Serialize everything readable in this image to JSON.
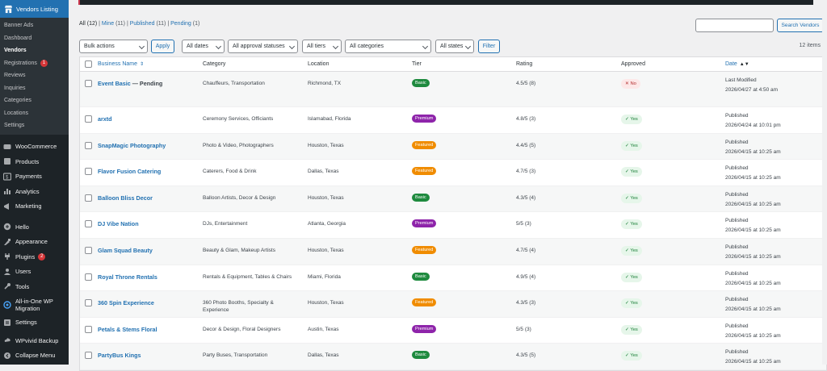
{
  "sidebar": {
    "active_plugin": "Vendors Listing",
    "submenu": [
      {
        "label": "Banner Ads"
      },
      {
        "label": "Dashboard"
      },
      {
        "label": "Vendors",
        "current": true
      },
      {
        "label": "Registrations",
        "badge": "1"
      },
      {
        "label": "Reviews"
      },
      {
        "label": "Inquiries"
      },
      {
        "label": "Categories"
      },
      {
        "label": "Locations"
      },
      {
        "label": "Settings"
      }
    ],
    "menu": [
      {
        "label": "WooCommerce",
        "icon": "woocommerce-icon"
      },
      {
        "label": "Products",
        "icon": "products-icon"
      },
      {
        "label": "Payments",
        "icon": "payments-icon"
      },
      {
        "label": "Analytics",
        "icon": "analytics-icon"
      },
      {
        "label": "Marketing",
        "icon": "marketing-icon"
      },
      {
        "label": "Hello",
        "icon": "hello-icon"
      },
      {
        "label": "Appearance",
        "icon": "appearance-icon"
      },
      {
        "label": "Plugins",
        "icon": "plugins-icon",
        "badge": "2"
      },
      {
        "label": "Users",
        "icon": "users-icon"
      },
      {
        "label": "Tools",
        "icon": "tools-icon"
      },
      {
        "label": "All-in-One WP Migration",
        "icon": "migration-icon"
      },
      {
        "label": "Settings",
        "icon": "settings-icon"
      },
      {
        "label": "WPvivid Backup",
        "icon": "backup-icon"
      },
      {
        "label": "Collapse Menu",
        "icon": "collapse-icon"
      }
    ]
  },
  "status_links": {
    "all": "All",
    "all_count": "(12)",
    "mine": "Mine",
    "mine_count": "(11)",
    "published": "Published",
    "published_count": "(11)",
    "pending": "Pending",
    "pending_count": "(1)",
    "sep": "|"
  },
  "search": {
    "placeholder": "",
    "button": "Search Vendors"
  },
  "filters": {
    "bulk_actions": "Bulk actions",
    "apply": "Apply",
    "dates": "All dates",
    "approval": "All approval statuses",
    "tiers": "All tiers",
    "categories": "All categories",
    "states": "All states",
    "filter": "Filter",
    "items_count": "12 items"
  },
  "table": {
    "headers": {
      "business_name": "Business Name",
      "category": "Category",
      "location": "Location",
      "tier": "Tier",
      "rating": "Rating",
      "approved": "Approved",
      "date": "Date"
    },
    "rows": [
      {
        "name": "Event Basic",
        "suffix": " — Pending",
        "category": "Chauffeurs, Transportation",
        "location": "Richmond, TX",
        "tier": "Basic",
        "tier_class": "basic",
        "rating": "4.5/5 (8)",
        "approved": "✕ No",
        "approved_class": "no",
        "date_status": "Last Modified",
        "date": "2026/04/27 at 4:50 am"
      },
      {
        "name": "arxtd",
        "suffix": "",
        "category": "Ceremony Services, Officiants",
        "location": "Islamabad, Florida",
        "tier": "Premium",
        "tier_class": "premium",
        "rating": "4.8/5 (3)",
        "approved": "✓ Yes",
        "approved_class": "yes",
        "date_status": "Published",
        "date": "2026/04/24 at 10:01 pm"
      },
      {
        "name": "SnapMagic Photography",
        "suffix": "",
        "category": "Photo & Video, Photographers",
        "location": "Houston, Texas",
        "tier": "Featured",
        "tier_class": "featured",
        "rating": "4.4/5 (5)",
        "approved": "✓ Yes",
        "approved_class": "yes",
        "date_status": "Published",
        "date": "2026/04/15 at 10:25 am"
      },
      {
        "name": "Flavor Fusion Catering",
        "suffix": "",
        "category": "Caterers, Food & Drink",
        "location": "Dallas, Texas",
        "tier": "Featured",
        "tier_class": "featured",
        "rating": "4.7/5 (3)",
        "approved": "✓ Yes",
        "approved_class": "yes",
        "date_status": "Published",
        "date": "2026/04/15 at 10:25 am"
      },
      {
        "name": "Balloon Bliss Decor",
        "suffix": "",
        "category": "Balloon Artists, Decor & Design",
        "location": "Houston, Texas",
        "tier": "Basic",
        "tier_class": "basic",
        "rating": "4.3/5 (4)",
        "approved": "✓ Yes",
        "approved_class": "yes",
        "date_status": "Published",
        "date": "2026/04/15 at 10:25 am"
      },
      {
        "name": "DJ Vibe Nation",
        "suffix": "",
        "category": "DJs, Entertainment",
        "location": "Atlanta, Georgia",
        "tier": "Premium",
        "tier_class": "premium",
        "rating": "5/5 (3)",
        "approved": "✓ Yes",
        "approved_class": "yes",
        "date_status": "Published",
        "date": "2026/04/15 at 10:25 am"
      },
      {
        "name": "Glam Squad Beauty",
        "suffix": "",
        "category": "Beauty & Glam, Makeup Artists",
        "location": "Houston, Texas",
        "tier": "Featured",
        "tier_class": "featured",
        "rating": "4.7/5 (4)",
        "approved": "✓ Yes",
        "approved_class": "yes",
        "date_status": "Published",
        "date": "2026/04/15 at 10:25 am"
      },
      {
        "name": "Royal Throne Rentals",
        "suffix": "",
        "category": "Rentals & Equipment, Tables & Chairs",
        "location": "Miami, Florida",
        "tier": "Basic",
        "tier_class": "basic",
        "rating": "4.9/5 (4)",
        "approved": "✓ Yes",
        "approved_class": "yes",
        "date_status": "Published",
        "date": "2026/04/15 at 10:25 am"
      },
      {
        "name": "360 Spin Experience",
        "suffix": "",
        "category": "360 Photo Booths, Specialty & Experience",
        "location": "Houston, Texas",
        "tier": "Featured",
        "tier_class": "featured",
        "rating": "4.3/5 (3)",
        "approved": "✓ Yes",
        "approved_class": "yes",
        "date_status": "Published",
        "date": "2026/04/15 at 10:25 am"
      },
      {
        "name": "Petals & Stems Floral",
        "suffix": "",
        "category": "Decor & Design, Floral Designers",
        "location": "Austin, Texas",
        "tier": "Premium",
        "tier_class": "premium",
        "rating": "5/5 (3)",
        "approved": "✓ Yes",
        "approved_class": "yes",
        "date_status": "Published",
        "date": "2026/04/15 at 10:25 am"
      },
      {
        "name": "PartyBus Kings",
        "suffix": "",
        "category": "Party Buses, Transportation",
        "location": "Dallas, Texas",
        "tier": "Basic",
        "tier_class": "basic",
        "rating": "4.3/5 (5)",
        "approved": "✓ Yes",
        "approved_class": "yes",
        "date_status": "Published",
        "date": "2026/04/15 at 10:25 am"
      }
    ]
  },
  "colors": {
    "sidebar_bg": "#1d2327",
    "accent": "#2271b1",
    "basic": "#1e8a3e",
    "premium": "#8e24aa",
    "featured": "#f08c00"
  }
}
